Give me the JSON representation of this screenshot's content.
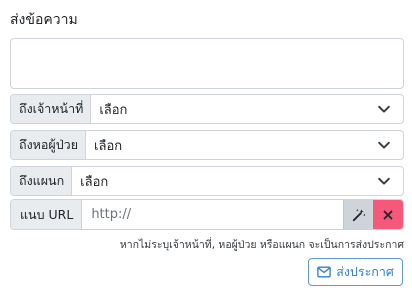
{
  "form": {
    "title": "ส่งข้อความ",
    "message_value": "",
    "rows": [
      {
        "label": "ถึงเจ้าหน้าที่",
        "value": "เลือก"
      },
      {
        "label": "ถึงหอผู้ป่วย",
        "value": "เลือก"
      },
      {
        "label": "ถึงแผนก",
        "value": "เลือก"
      }
    ],
    "url": {
      "label": "แนบ URL",
      "placeholder": "http://"
    },
    "hint": "หากไม่ระบุเจ้าหน้าที่, หอผู้ป่วย หรือแผนก จะเป็นการส่งประกาศ",
    "send_label": "ส่งประกาศ"
  },
  "colors": {
    "clear_button": "#f5587a",
    "send_button": "#2f7fd0",
    "magic_button": "#ced4da"
  },
  "icons": {
    "select": "chevron-down-icon",
    "magic": "magic-wand-icon",
    "clear": "close-icon",
    "send": "envelope-icon"
  }
}
